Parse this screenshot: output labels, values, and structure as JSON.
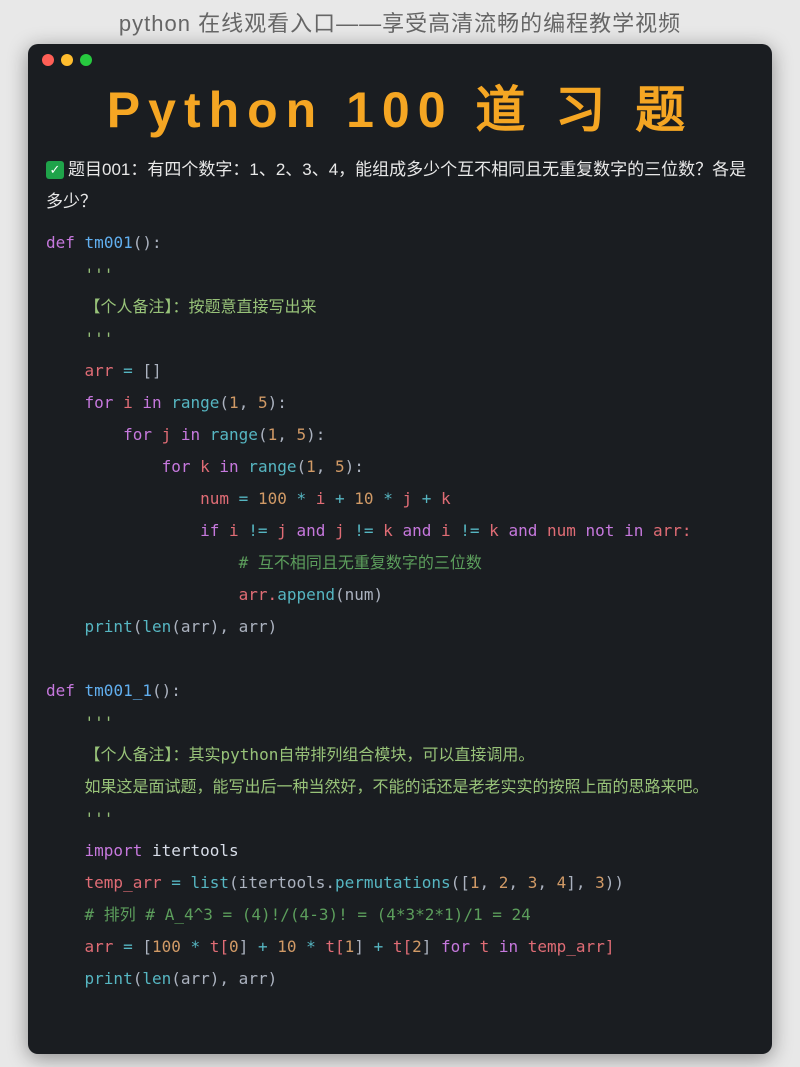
{
  "header": "python 在线观看入口——享受高清流畅的编程教学视频",
  "title": "Python 100 道 习 题",
  "checkmark": "✓",
  "problem": "题目001：有四个数字：1、2、3、4，能组成多少个互不相同且无重复数字的三位数？各是多少？",
  "code": {
    "l1_def": "def",
    "l1_fn": "tm001",
    "l1_rest": "():",
    "l2": "    '''",
    "l3": "    【个人备注】：按题意直接写出来",
    "l4": "    '''",
    "l5_a": "    arr ",
    "l5_b": "=",
    "l5_c": " []",
    "l6_a": "    ",
    "l6_for": "for",
    "l6_i": " i ",
    "l6_in": "in",
    "l6_r": " range",
    "l6_p": "(",
    "l6_n1": "1",
    "l6_c": ", ",
    "l6_n2": "5",
    "l6_e": "):",
    "l7_a": "        ",
    "l7_for": "for",
    "l7_j": " j ",
    "l7_in": "in",
    "l7_r": " range",
    "l7_p": "(",
    "l7_n1": "1",
    "l7_c": ", ",
    "l7_n2": "5",
    "l7_e": "):",
    "l8_a": "            ",
    "l8_for": "for",
    "l8_k": " k ",
    "l8_in": "in",
    "l8_r": " range",
    "l8_p": "(",
    "l8_n1": "1",
    "l8_c": ", ",
    "l8_n2": "5",
    "l8_e": "):",
    "l9_a": "                num ",
    "l9_eq": "=",
    "l9_b": " ",
    "l9_100": "100",
    "l9_m1": " * ",
    "l9_i": "i",
    "l9_p1": " + ",
    "l9_10": "10",
    "l9_m2": " * ",
    "l9_j": "j",
    "l9_p2": " + ",
    "l9_k": "k",
    "l10_a": "                ",
    "l10_if": "if",
    "l10_b": " i ",
    "l10_ne1": "!=",
    "l10_c": " j ",
    "l10_and1": "and",
    "l10_d": " j ",
    "l10_ne2": "!=",
    "l10_e": " k ",
    "l10_and2": "and",
    "l10_f": " i ",
    "l10_ne3": "!=",
    "l10_g": " k ",
    "l10_and3": "and",
    "l10_h": " num ",
    "l10_not": "not",
    "l10_sp": " ",
    "l10_in": "in",
    "l10_i": " arr:",
    "l11": "                    # 互不相同且无重复数字的三位数",
    "l12_a": "                    arr.",
    "l12_ap": "append",
    "l12_b": "(num)",
    "l13_a": "    ",
    "l13_pr": "print",
    "l13_b": "(",
    "l13_len": "len",
    "l13_c": "(arr), arr)",
    "blank": "",
    "l14_def": "def",
    "l14_fn": " tm001_1",
    "l14_rest": "():",
    "l15": "    '''",
    "l16": "    【个人备注】：其实python自带排列组合模块，可以直接调用。",
    "l17": "    如果这是面试题，能写出后一种当然好，不能的话还是老老实实的按照上面的思路来吧。",
    "l17b": "    '''",
    "l18_a": "    ",
    "l18_imp": "import",
    "l18_b": " itertools",
    "l19_a": "    temp_arr ",
    "l19_eq": "=",
    "l19_b": " ",
    "l19_list": "list",
    "l19_c": "(itertools.",
    "l19_perm": "permutations",
    "l19_d": "([",
    "l19_n1": "1",
    "l19_c1": ", ",
    "l19_n2": "2",
    "l19_c2": ", ",
    "l19_n3": "3",
    "l19_c3": ", ",
    "l19_n4": "4",
    "l19_e": "], ",
    "l19_n5": "3",
    "l19_f": "))",
    "l20": "    # 排列 # A_4^3 = (4)!/(4-3)! = (4*3*2*1)/1 = 24",
    "l21_a": "    arr ",
    "l21_eq": "=",
    "l21_b": " [",
    "l21_100": "100",
    "l21_m1": " * ",
    "l21_t0": "t[",
    "l21_0": "0",
    "l21_cb0": "]",
    "l21_p1": " + ",
    "l21_10": "10",
    "l21_m2": " * ",
    "l21_t1": "t[",
    "l21_1": "1",
    "l21_cb1": "]",
    "l21_p2": " + ",
    "l21_t2": "t[",
    "l21_2": "2",
    "l21_cb2": "]",
    "l21_sp": " ",
    "l21_for": "for",
    "l21_c": " t ",
    "l21_in": "in",
    "l21_d": " temp_arr]",
    "l22_a": "    ",
    "l22_pr": "print",
    "l22_b": "(",
    "l22_len": "len",
    "l22_c": "(arr), arr)"
  }
}
